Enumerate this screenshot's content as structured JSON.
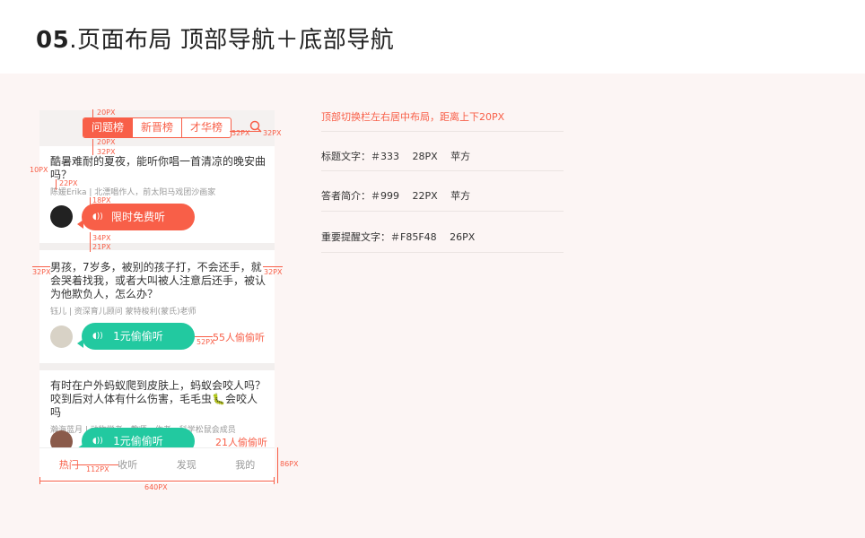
{
  "page": {
    "title_number": "05",
    "title_text": ".页面布局 顶部导航＋底部导航"
  },
  "topbar": {
    "tabs": [
      "问题榜",
      "新晋榜",
      "才华榜"
    ],
    "active_tab": 0,
    "icon": "search-icon"
  },
  "cards": [
    {
      "question": "酷暑难耐的夏夜，能听你唱一首清凉的晚安曲吗？",
      "author": "陈媛Erika",
      "author_desc": "北漂唱作人，前太阳马戏团沙画家",
      "button": "限时免费听",
      "listens": ""
    },
    {
      "question": "男孩，7岁多，被别的孩子打，不会还手，就会哭着找我，或者大叫被人注意后还手，被认为他欺负人，怎么办？",
      "author": "钰儿",
      "author_desc": "资深育儿顾问 蒙特梭利(蒙氏)老师",
      "button": "1元偷偷听",
      "listens": "55人偷偷听"
    },
    {
      "question": "有时在户外蚂蚁爬到皮肤上，蚂蚁会咬人吗？咬到后对人体有什么伤害，毛毛虫🐛会咬人吗",
      "author": "瀚海蓝月",
      "author_desc": "动物学者，教师，作者，科学松鼠会成员",
      "button": "1元偷偷听",
      "listens": "21人偷偷听"
    }
  ],
  "bottom_nav": [
    "热门",
    "收听",
    "发现",
    "我的"
  ],
  "bottom_nav_active": 0,
  "annotations": {
    "a20_top": "20PX",
    "a52": "52PX",
    "a32_right": "32PX",
    "a20_bottom": "20PX",
    "a32_below": "32PX",
    "a10": "10PX",
    "a22": "22PX",
    "a18": "18PX",
    "a34": "34PX",
    "a21": "21PX",
    "a32_left": "32PX",
    "a32_right2": "32PX",
    "a52_bubble": "52PX",
    "a112": "112PX",
    "a640": "640PX",
    "a86": "86PX"
  },
  "specs": [
    "顶部切换栏左右居中布局，距离上下20PX",
    "标题文字：＃333　 28PX　 苹方",
    "答者简介：＃999　 22PX　 苹方",
    "重要提醒文字：＃F85F48　 26PX"
  ],
  "colors": {
    "accent": "#f85f48",
    "green": "#22c9a0",
    "title": "#333333",
    "subtitle": "#999999"
  }
}
